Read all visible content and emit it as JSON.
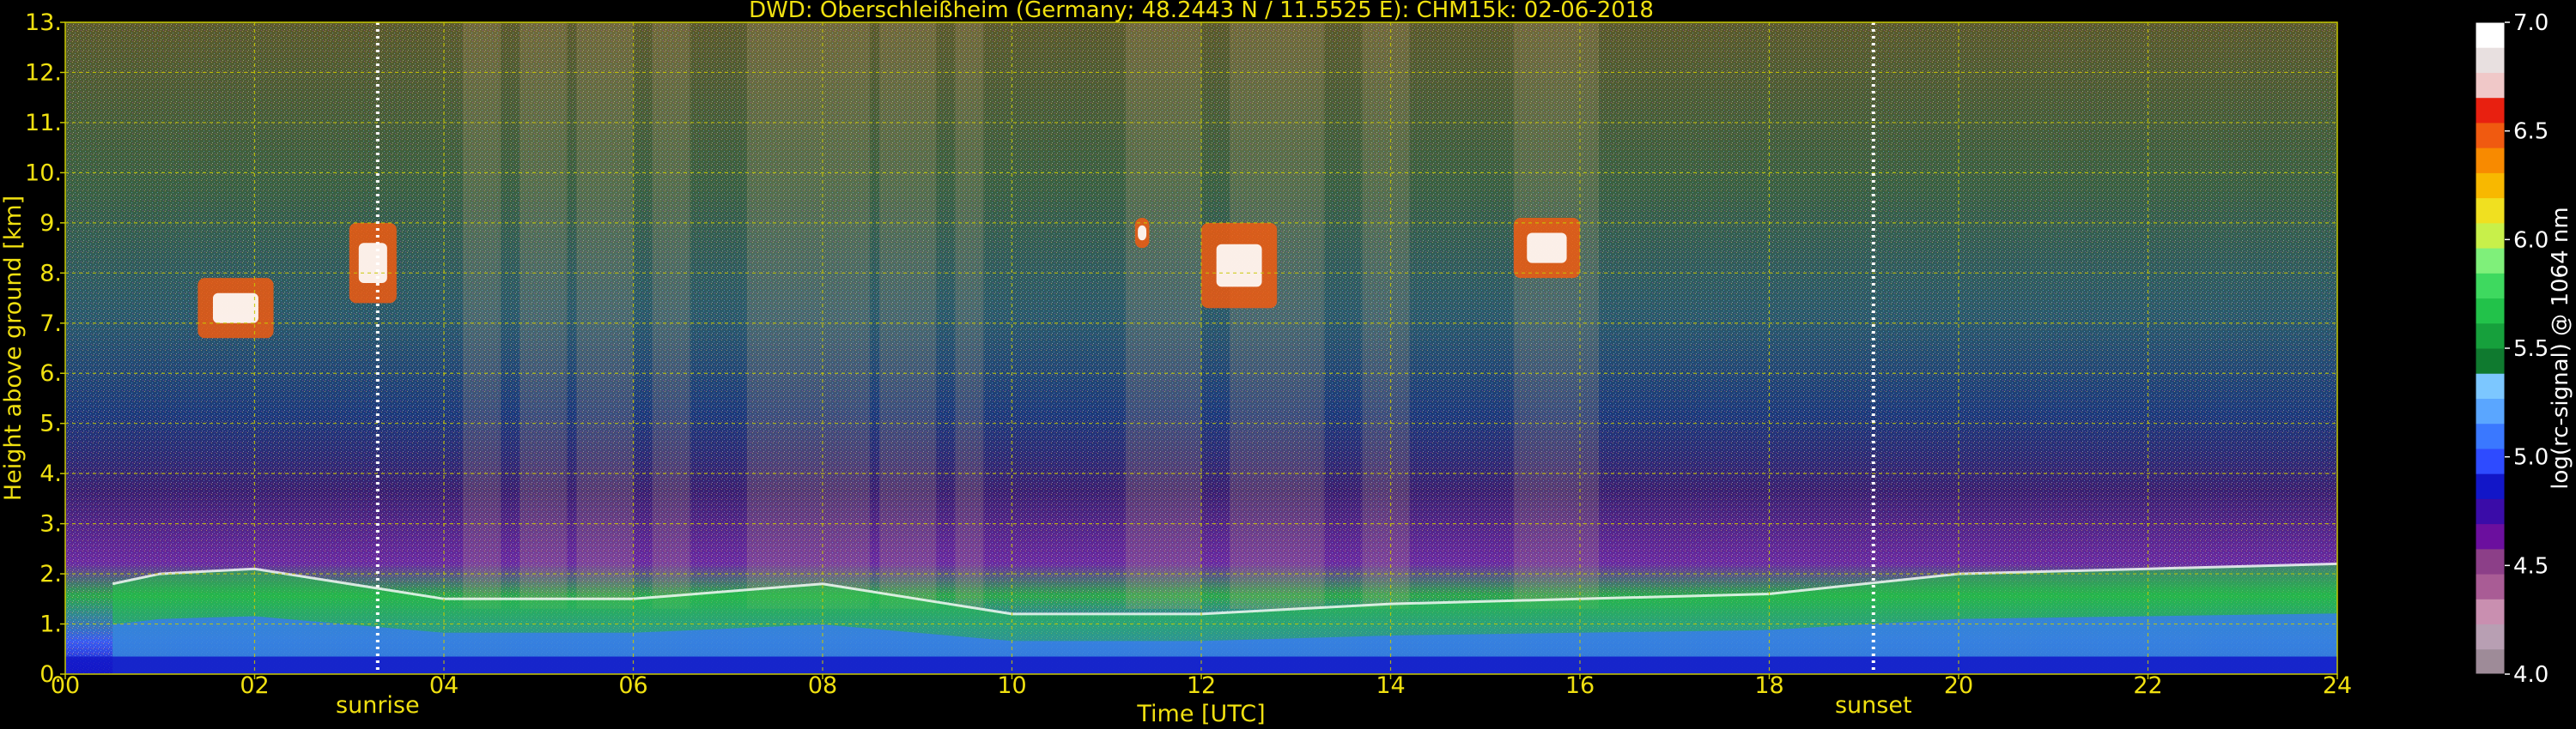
{
  "chart_data": {
    "type": "heatmap",
    "title": "DWD: Oberschleißheim (Germany; 48.2443 N / 11.5525 E):    CHM15k: 02-06-2018",
    "xlabel": "Time [UTC]",
    "ylabel": "Height above ground [km]",
    "xlim": [
      0,
      24
    ],
    "ylim": [
      0,
      13
    ],
    "x_ticks": [
      "00",
      "02",
      "04",
      "06",
      "08",
      "10",
      "12",
      "14",
      "16",
      "18",
      "20",
      "22",
      "24"
    ],
    "y_ticks": [
      "0.",
      "1.",
      "2.",
      "3.",
      "4.",
      "5.",
      "6.",
      "7.",
      "8.",
      "9.",
      "10.",
      "11.",
      "12.",
      "13."
    ],
    "grid": true,
    "annotations": [
      {
        "label": "sunrise",
        "x": 3.3
      },
      {
        "label": "sunset",
        "x": 19.1
      }
    ],
    "colorbar": {
      "label": "log(rc-signal) @ 1064 nm",
      "range": [
        4.0,
        7.0
      ],
      "tick_labels": [
        "4.0",
        "4.5",
        "5.0",
        "5.5",
        "6.0",
        "6.5",
        "7.0"
      ],
      "colors": [
        "#9e8b98",
        "#b89fb3",
        "#c98fb0",
        "#a95c95",
        "#8c3f88",
        "#6b0f9e",
        "#3a0ca8",
        "#1216c8",
        "#2e4bff",
        "#3a78ff",
        "#5aa6ff",
        "#7cc7ff",
        "#0f7a2f",
        "#16a03c",
        "#22c24a",
        "#3ed95f",
        "#7ff07a",
        "#c8f04a",
        "#f0e020",
        "#f8b800",
        "#f88a00",
        "#f05a10",
        "#e82010",
        "#f0c8c8",
        "#e8e0e0",
        "#ffffff"
      ]
    },
    "cloud_layers_km": [
      {
        "x_range": [
          1.4,
          2.2
        ],
        "height_range": [
          6.7,
          7.9
        ]
      },
      {
        "x_range": [
          3.0,
          3.5
        ],
        "height_range": [
          7.4,
          9.0
        ]
      },
      {
        "x_range": [
          11.3,
          11.45
        ],
        "height_range": [
          8.5,
          9.1
        ]
      },
      {
        "x_range": [
          12.0,
          12.8
        ],
        "height_range": [
          7.3,
          9.0
        ]
      },
      {
        "x_range": [
          15.3,
          16.0
        ],
        "height_range": [
          7.9,
          9.1
        ]
      }
    ],
    "boundary_layer_top_km": [
      {
        "x": 0.5,
        "y": 1.8
      },
      {
        "x": 1.0,
        "y": 2.0
      },
      {
        "x": 2.0,
        "y": 2.1
      },
      {
        "x": 4.0,
        "y": 1.5
      },
      {
        "x": 6.0,
        "y": 1.5
      },
      {
        "x": 8.0,
        "y": 1.8
      },
      {
        "x": 10.0,
        "y": 1.2
      },
      {
        "x": 12.0,
        "y": 1.2
      },
      {
        "x": 14.0,
        "y": 1.4
      },
      {
        "x": 16.0,
        "y": 1.5
      },
      {
        "x": 18.0,
        "y": 1.6
      },
      {
        "x": 20.0,
        "y": 2.0
      },
      {
        "x": 22.0,
        "y": 2.1
      },
      {
        "x": 24.0,
        "y": 2.2
      }
    ]
  }
}
